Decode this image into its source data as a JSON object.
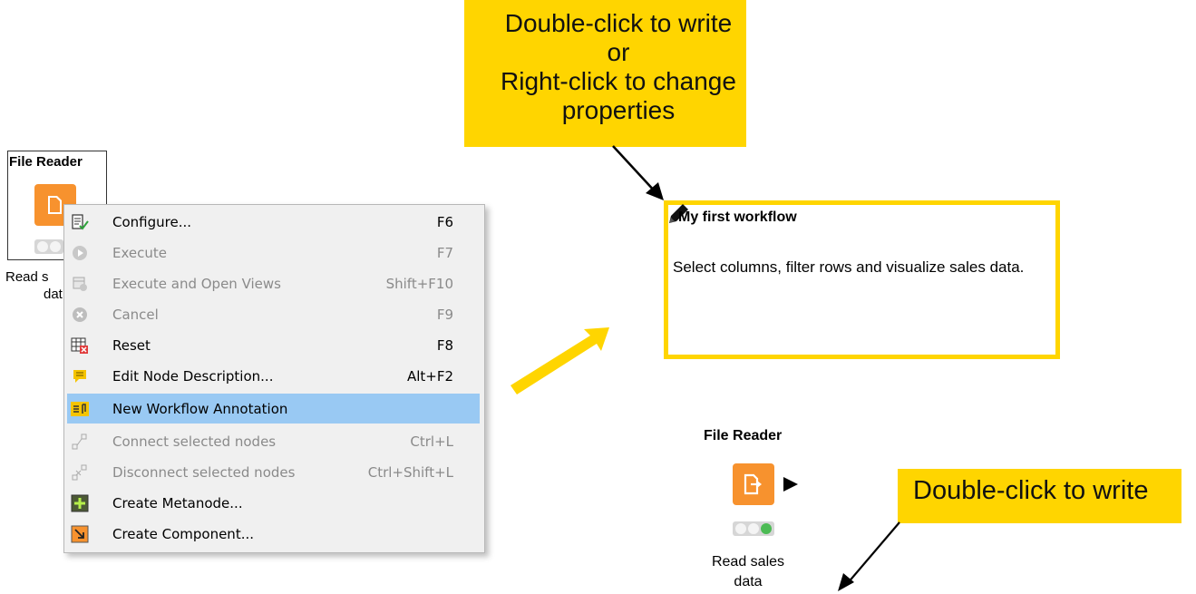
{
  "left_node": {
    "title": "File Reader",
    "label_line1": "Read s",
    "label_line2": "dat"
  },
  "context_menu": {
    "items": [
      {
        "label": "Configure...",
        "shortcut": "F6",
        "icon": "configure-icon",
        "enabled": true
      },
      {
        "label": "Execute",
        "shortcut": "F7",
        "icon": "execute-icon",
        "enabled": false
      },
      {
        "label": "Execute and Open Views",
        "shortcut": "Shift+F10",
        "icon": "execute-open-views-icon",
        "enabled": false
      },
      {
        "label": "Cancel",
        "shortcut": "F9",
        "icon": "cancel-icon",
        "enabled": false
      },
      {
        "label": "Reset",
        "shortcut": "F8",
        "icon": "reset-icon",
        "enabled": true
      },
      {
        "label": "Edit Node Description...",
        "shortcut": "Alt+F2",
        "icon": "edit-description-icon",
        "enabled": true
      },
      {
        "label": "New Workflow Annotation",
        "shortcut": "",
        "icon": "workflow-annotation-icon",
        "enabled": true,
        "highlighted": true
      },
      {
        "label": "Connect selected nodes",
        "shortcut": "Ctrl+L",
        "icon": "connect-nodes-icon",
        "enabled": false
      },
      {
        "label": "Disconnect selected nodes",
        "shortcut": "Ctrl+Shift+L",
        "icon": "disconnect-nodes-icon",
        "enabled": false
      },
      {
        "label": "Create Metanode...",
        "shortcut": "",
        "icon": "create-metanode-icon",
        "enabled": true
      },
      {
        "label": "Create Component...",
        "shortcut": "",
        "icon": "create-component-icon",
        "enabled": true
      }
    ]
  },
  "callout_top": {
    "line1": "Double-click to write",
    "line2": "or",
    "line3": "Right-click to change",
    "line4": "properties"
  },
  "annotation": {
    "title": "My first workflow",
    "body": "Select columns, filter rows and visualize sales data."
  },
  "right_node": {
    "title": "File Reader",
    "label_line1": "Read sales",
    "label_line2": "data"
  },
  "callout_bottom": {
    "text": "Double-click to write"
  },
  "colors": {
    "callout_yellow": "#ffd500",
    "node_orange": "#f7922e",
    "menu_highlight": "#99c9f3",
    "status_green": "#4cbb54"
  }
}
